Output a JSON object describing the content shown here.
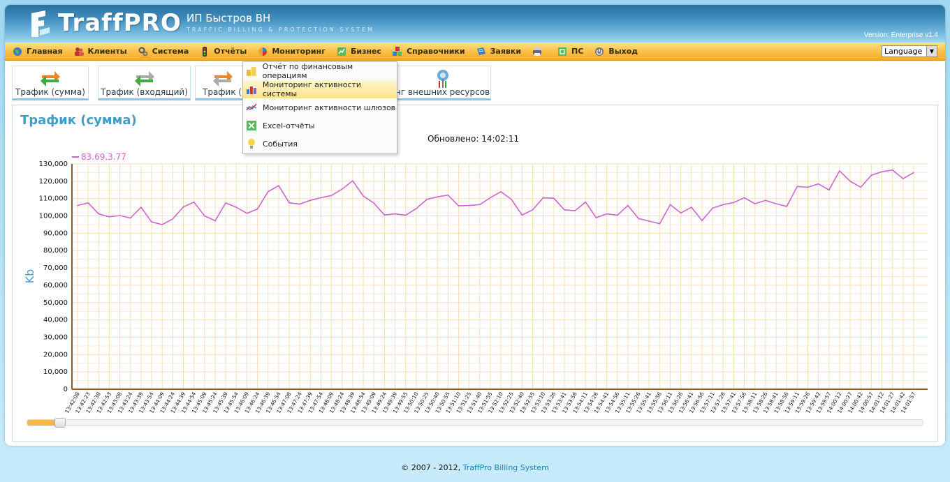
{
  "header": {
    "logo_text": "TraffPRO",
    "org_name": "ИП Быстров ВН",
    "tagline": "TRAFFIC BILLING & PROTECTION SYSTEM",
    "version": "Version: Enterprise v1.4"
  },
  "menu": {
    "items": [
      {
        "label": "Главная",
        "icon": "globe-icon"
      },
      {
        "label": "Клиенты",
        "icon": "users-icon"
      },
      {
        "label": "Система",
        "icon": "gears-icon"
      },
      {
        "label": "Отчёты",
        "icon": "traffic-light-icon"
      },
      {
        "label": "Мониторинг",
        "icon": "monitor-pie-icon"
      },
      {
        "label": "Бизнес",
        "icon": "business-icon"
      },
      {
        "label": "Справочники",
        "icon": "blocks-icon"
      },
      {
        "label": "Заявки",
        "icon": "requests-icon"
      },
      {
        "label": "",
        "icon": "printer-icon"
      },
      {
        "label": "ПС",
        "icon": "ps-icon"
      },
      {
        "label": "Выход",
        "icon": "power-icon"
      }
    ],
    "language_label": "Language"
  },
  "dropdown": {
    "items": [
      {
        "label": "Отчёт по финансовым операциям",
        "icon": "coins-icon"
      },
      {
        "label": "Мониторинг активности системы",
        "icon": "bar-chart-icon"
      },
      {
        "label": "Мониторинг активности шлюзов",
        "icon": "line-chart-icon"
      },
      {
        "label": "Excel-отчёты",
        "icon": "excel-icon"
      },
      {
        "label": "События",
        "icon": "bulb-icon"
      }
    ]
  },
  "tabs": [
    {
      "label": "Трафик (сумма)",
      "icon": "arrows-icon"
    },
    {
      "label": "Трафик (входящий)",
      "icon": "arrows-in-icon"
    },
    {
      "label": "Трафик (ис",
      "icon": "arrows-out-icon"
    },
    {
      "label": "нг внешних ресурсов",
      "icon": "globe-signal-icon"
    }
  ],
  "panel": {
    "title": "Трафик (сумма)",
    "updated_label": "Обновлено: 14:02:11"
  },
  "slider": {
    "range_end": 0.03
  },
  "chart_data": {
    "type": "line",
    "ylabel": "Kb",
    "ylim": [
      0,
      130000
    ],
    "yticks": [
      "0",
      "10,000",
      "20,000",
      "30,000",
      "40,000",
      "50,000",
      "60,000",
      "70,000",
      "80,000",
      "90,000",
      "100,000",
      "110,000",
      "120,000",
      "130,000"
    ],
    "series": [
      {
        "name": "83.69.3.77",
        "color": "#cc66cc",
        "values": [
          106000,
          107500,
          101200,
          99500,
          100200,
          98800,
          105000,
          96500,
          95000,
          98300,
          105200,
          108000,
          100000,
          97200,
          107500,
          105000,
          101500,
          104000,
          114000,
          117500,
          107600,
          106800,
          109000,
          110500,
          111800,
          115500,
          120200,
          111500,
          107400,
          100500,
          101200,
          100400,
          104200,
          109500,
          111000,
          112000,
          105800,
          106000,
          106500,
          110500,
          114000,
          109500,
          100500,
          103500,
          110500,
          110200,
          103500,
          103000,
          108000,
          99000,
          101200,
          100400,
          106000,
          98500,
          97000,
          95500,
          106500,
          101700,
          105000,
          97300,
          104500,
          106500,
          107700,
          110500,
          107000,
          109000,
          107000,
          105500,
          117000,
          116500,
          118500,
          115000,
          126000,
          120000,
          116500,
          123500,
          125500,
          126500,
          121500,
          125000
        ],
        "x": [
          "13:42:08",
          "13:42:23",
          "13:42:38",
          "13:42:53",
          "13:43:08",
          "13:43:24",
          "13:43:39",
          "13:43:54",
          "13:44:09",
          "13:44:24",
          "13:44:39",
          "13:44:54",
          "13:45:09",
          "13:45:24",
          "13:45:39",
          "13:45:54",
          "13:46:09",
          "13:46:24",
          "13:46:39",
          "13:46:54",
          "13:47:08",
          "13:47:24",
          "13:47:39",
          "13:47:54",
          "13:48:09",
          "13:48:24",
          "13:48:39",
          "13:48:54",
          "13:49:09",
          "13:49:24",
          "13:49:39",
          "13:49:55",
          "13:50:10",
          "13:50:25",
          "13:50:40",
          "13:50:55",
          "13:51:10",
          "13:51:25",
          "13:51:40",
          "13:51:55",
          "13:52:10",
          "13:52:25",
          "13:52:40",
          "13:52:55",
          "13:53:10",
          "13:53:26",
          "13:53:41",
          "13:53:56",
          "13:54:11",
          "13:54:26",
          "13:54:41",
          "13:54:56",
          "13:55:11",
          "13:55:26",
          "13:55:41",
          "13:55:56",
          "13:56:11",
          "13:56:26",
          "13:56:41",
          "13:56:56",
          "13:57:11",
          "13:57:26",
          "13:57:41",
          "13:57:56",
          "13:58:11",
          "13:58:26",
          "13:58:41",
          "13:58:56",
          "13:59:11",
          "13:59:26",
          "13:59:42",
          "13:59:57",
          "14:00:12",
          "14:00:27",
          "14:00:42",
          "14:00:57",
          "14:01:12",
          "14:01:27",
          "14:01:42",
          "14:01:57"
        ]
      }
    ]
  },
  "footer": {
    "copyright": "© 2007 - 2012, ",
    "link": "TraffPro Billing System"
  }
}
